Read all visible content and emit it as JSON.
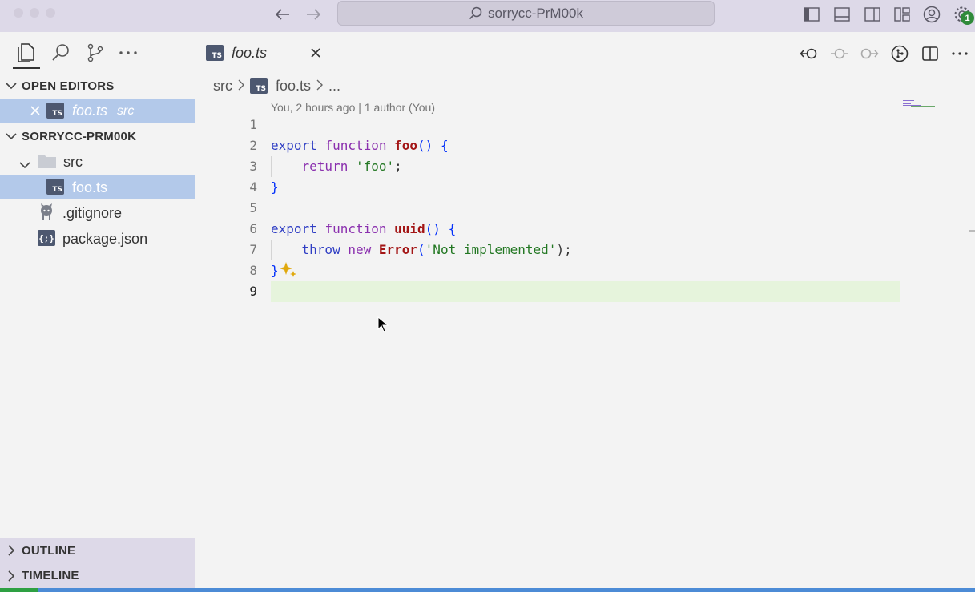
{
  "window": {
    "title": "sorrycc-PrM00k",
    "notification_count": "1"
  },
  "activity": {
    "items": [
      "explorer-icon",
      "search-icon",
      "source-control-icon",
      "more-icon"
    ]
  },
  "sidebar": {
    "open_editors": {
      "header": "OPEN EDITORS",
      "items": [
        {
          "name": "foo.ts",
          "desc": "src",
          "badge": "TS"
        }
      ]
    },
    "project": {
      "header": "SORRYCC-PRM00K",
      "folder": "src",
      "file": "foo.ts",
      "file_badge": "TS",
      "gitignore": ".gitignore",
      "package": "package.json"
    },
    "outline": "OUTLINE",
    "timeline": "TIMELINE"
  },
  "tab": {
    "title": "foo.ts",
    "badge": "TS"
  },
  "breadcrumb": {
    "folder": "src",
    "file": "foo.ts",
    "badge": "TS",
    "tail": "..."
  },
  "blame": "You, 2 hours ago | 1 author (You)",
  "editor": {
    "line_numbers": [
      "1",
      "2",
      "3",
      "4",
      "5",
      "6",
      "7",
      "8",
      "9"
    ],
    "active_line": "9",
    "lines": [
      [],
      [
        {
          "t": "export ",
          "c": "kw"
        },
        {
          "t": "function ",
          "c": "kw2"
        },
        {
          "t": "foo",
          "c": "fn"
        },
        {
          "t": "() ",
          "c": "br"
        },
        {
          "t": "{",
          "c": "br"
        }
      ],
      [
        {
          "t": "    return ",
          "c": "kw2"
        },
        {
          "t": "'foo'",
          "c": "str"
        },
        {
          "t": ";",
          "c": ""
        }
      ],
      [
        {
          "t": "}",
          "c": "br"
        }
      ],
      [],
      [
        {
          "t": "export ",
          "c": "kw"
        },
        {
          "t": "function ",
          "c": "kw2"
        },
        {
          "t": "uuid",
          "c": "fn"
        },
        {
          "t": "() ",
          "c": "br"
        },
        {
          "t": "{",
          "c": "br"
        }
      ],
      [
        {
          "t": "    throw ",
          "c": "kw"
        },
        {
          "t": "new ",
          "c": "kw2"
        },
        {
          "t": "Error",
          "c": "fn"
        },
        {
          "t": "(",
          "c": "br"
        },
        {
          "t": "'Not implemented'",
          "c": "str"
        },
        {
          "t": ");",
          "c": ""
        }
      ],
      [
        {
          "t": "}",
          "c": "br"
        }
      ],
      []
    ]
  },
  "colors": {
    "selection": "#b3c9ea",
    "statusbar": "#4c8bd6",
    "highlight_line": "#e6f4dc"
  }
}
